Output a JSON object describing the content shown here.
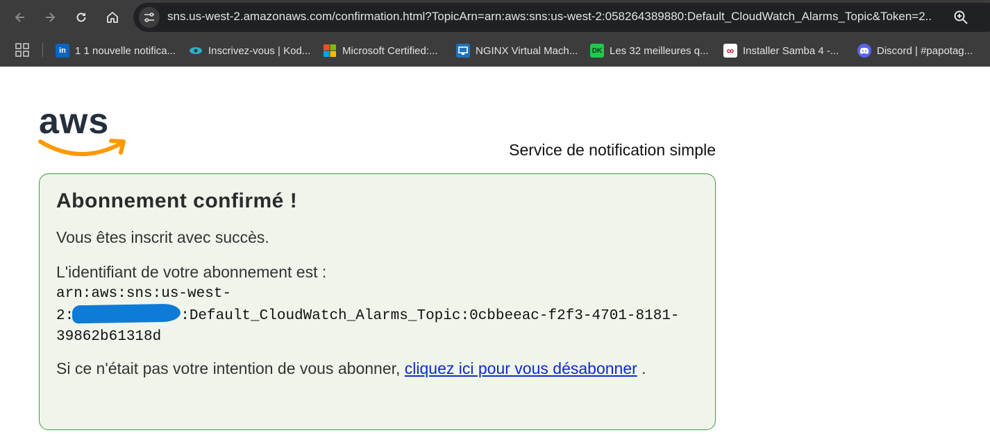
{
  "browser": {
    "url": "sns.us-west-2.amazonaws.com/confirmation.html?TopicArn=arn:aws:sns:us-west-2:058264389880:Default_CloudWatch_Alarms_Topic&Token=2...",
    "bookmarks": [
      {
        "label": "1 1 nouvelle notifica...",
        "icon": "linkedin-icon",
        "color": "#0a66c2",
        "glyph": "in"
      },
      {
        "label": "Inscrivez-vous | Kod...",
        "icon": "eye-logo-icon",
        "color": "#2bb0c9",
        "glyph": ""
      },
      {
        "label": "Microsoft Certified:...",
        "icon": "microsoft-icon",
        "color": "#f25022",
        "glyph": ""
      },
      {
        "label": "NGINX Virtual Mach...",
        "icon": "nginx-vm-icon",
        "color": "#1e73be",
        "glyph": ""
      },
      {
        "label": "Les 32 meilleures q...",
        "icon": "dk-icon",
        "color": "#1fc94a",
        "glyph": "DK"
      },
      {
        "label": "Installer Samba 4 -...",
        "icon": "infinity-icon",
        "color": "#ffffff",
        "glyph": "∞"
      },
      {
        "label": "Discord | #papotag...",
        "icon": "discord-icon",
        "color": "#5865f2",
        "glyph": ""
      }
    ]
  },
  "page": {
    "service_name": "Service de notification simple",
    "title": "Abonnement confirmé !",
    "success_text": "Vous êtes inscrit avec succès.",
    "id_label": "L'identifiant de votre abonnement est :",
    "arn_line1": "arn:aws:sns:us-west-",
    "arn_line2_prefix": "2:",
    "arn_line2_suffix": ":Default_CloudWatch_Alarms_Topic:0cbbeeac-f2f3-4701-8181-",
    "arn_line3": "39862b61318d",
    "unsub_prefix": "Si ce n'était pas votre intention de vous abonner,",
    "unsub_link": "cliquez ici pour vous désabonner",
    "unsub_suffix": "."
  },
  "colors": {
    "chrome_bg": "#3c3c3c",
    "panel_bg": "#f0f5ec",
    "panel_border": "#3b9b3b",
    "link": "#0b2bcd",
    "redaction": "#0e7bd6",
    "aws_text": "#252f3e",
    "aws_smile": "#ff9900"
  }
}
